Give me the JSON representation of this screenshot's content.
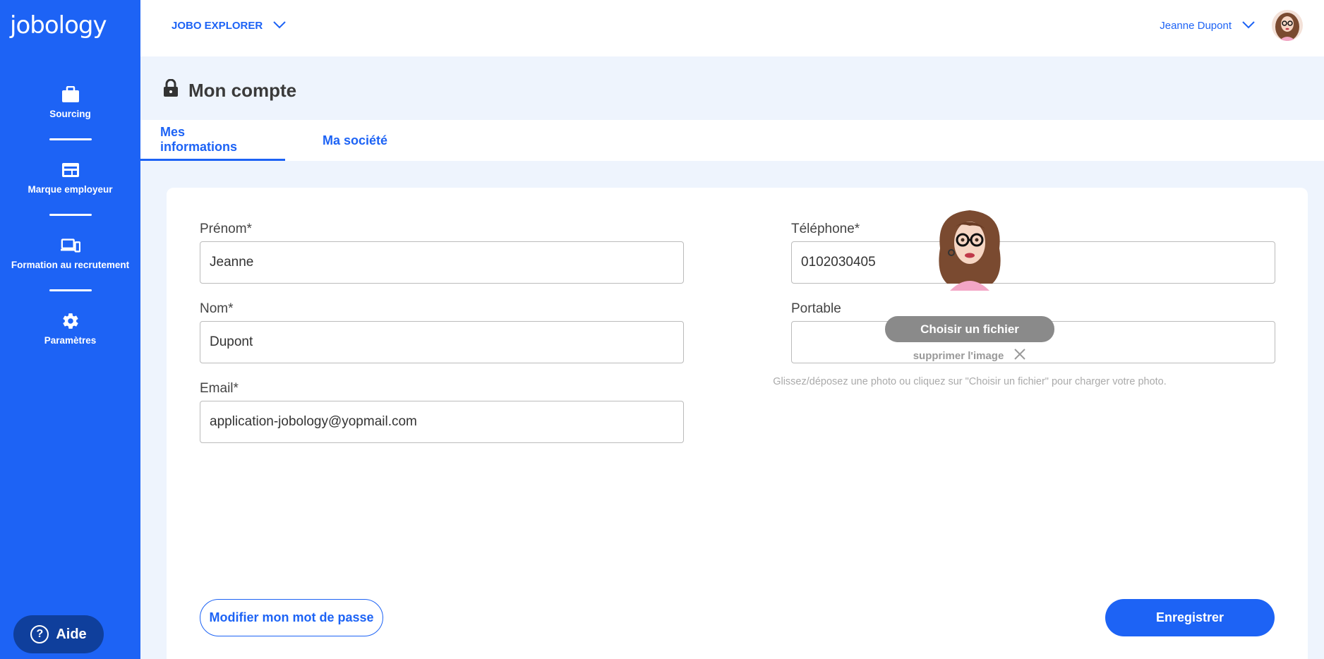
{
  "app": {
    "logo_text": "jobology"
  },
  "sidebar": {
    "items": [
      {
        "label": "Sourcing",
        "icon": "briefcase-icon"
      },
      {
        "label": "Marque employeur",
        "icon": "card-icon"
      },
      {
        "label": "Formation au recrutement",
        "icon": "devices-icon"
      },
      {
        "label": "Paramètres",
        "icon": "gear-icon"
      }
    ],
    "help_label": "Aide",
    "help_icon": "?"
  },
  "topbar": {
    "explorer_label": "JOBO EXPLORER",
    "user_name": "Jeanne Dupont"
  },
  "page": {
    "title": "Mon compte"
  },
  "tabs": [
    {
      "label": "Mes informations",
      "active": true
    },
    {
      "label": "Ma société",
      "active": false
    }
  ],
  "form": {
    "prenom": {
      "label": "Prénom*",
      "value": "Jeanne"
    },
    "nom": {
      "label": "Nom*",
      "value": "Dupont"
    },
    "email": {
      "label": "Email*",
      "value": "application-jobology@yopmail.com"
    },
    "telephone": {
      "label": "Téléphone*",
      "value": "0102030405"
    },
    "portable": {
      "label": "Portable",
      "value": ""
    }
  },
  "photo": {
    "choose_label": "Choisir un fichier",
    "remove_label": "supprimer l'image",
    "hint": "Glissez/déposez une photo ou cliquez sur \"Choisir un fichier\" pour charger votre photo."
  },
  "actions": {
    "change_password": "Modifier mon mot de passe",
    "save": "Enregistrer"
  },
  "colors": {
    "brand": "#1d63f5",
    "page_bg": "#eef4fd"
  }
}
